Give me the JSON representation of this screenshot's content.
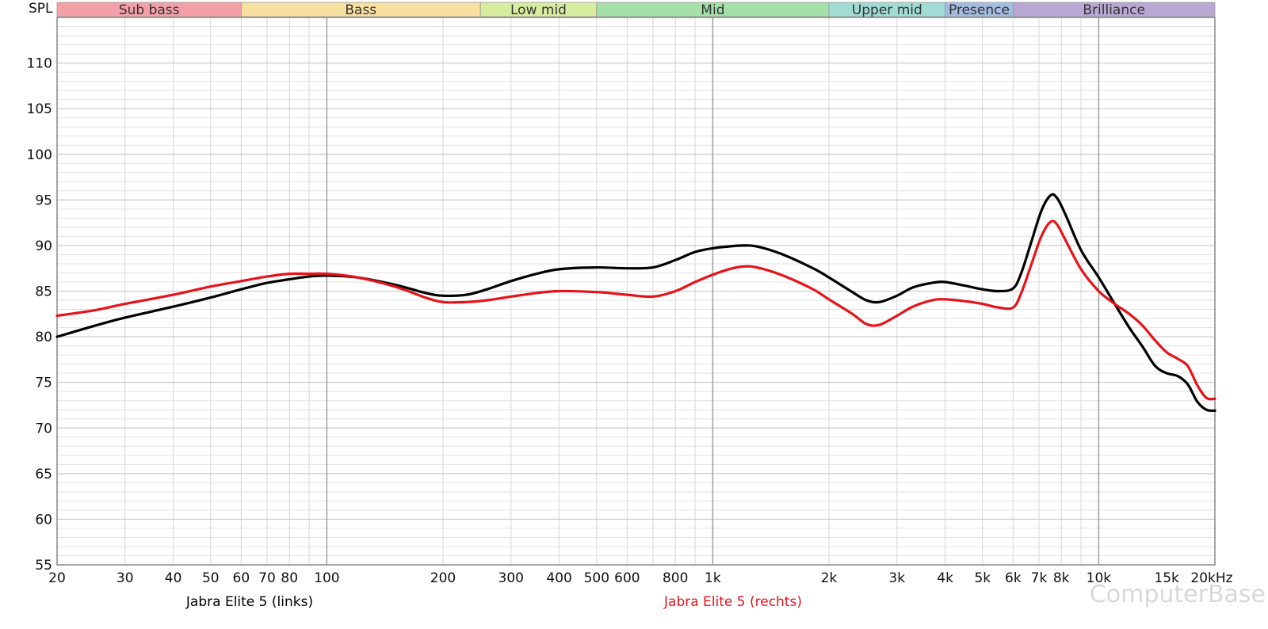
{
  "chart_data": {
    "type": "line",
    "ylabel": "SPL",
    "xscale": "log",
    "xlim": [
      20,
      20000
    ],
    "ylim": [
      55,
      115
    ],
    "grid": true,
    "xticks": [
      {
        "v": 20,
        "label": "20"
      },
      {
        "v": 30,
        "label": "30"
      },
      {
        "v": 40,
        "label": "40"
      },
      {
        "v": 50,
        "label": "50"
      },
      {
        "v": 60,
        "label": "60"
      },
      {
        "v": 70,
        "label": "70"
      },
      {
        "v": 80,
        "label": "80"
      },
      {
        "v": 100,
        "label": "100"
      },
      {
        "v": 200,
        "label": "200"
      },
      {
        "v": 300,
        "label": "300"
      },
      {
        "v": 400,
        "label": "400"
      },
      {
        "v": 500,
        "label": "500"
      },
      {
        "v": 600,
        "label": "600"
      },
      {
        "v": 800,
        "label": "800"
      },
      {
        "v": 1000,
        "label": "1k"
      },
      {
        "v": 2000,
        "label": "2k"
      },
      {
        "v": 3000,
        "label": "3k"
      },
      {
        "v": 4000,
        "label": "4k"
      },
      {
        "v": 5000,
        "label": "5k"
      },
      {
        "v": 6000,
        "label": "6k"
      },
      {
        "v": 7000,
        "label": "7k"
      },
      {
        "v": 8000,
        "label": "8k"
      },
      {
        "v": 10000,
        "label": "10k"
      },
      {
        "v": 15000,
        "label": "15k"
      },
      {
        "v": 20000,
        "label": "20kHz"
      }
    ],
    "yticks": [
      55,
      60,
      65,
      70,
      75,
      80,
      85,
      90,
      95,
      100,
      105,
      110
    ],
    "bands": [
      {
        "name": "Sub bass",
        "from": 20,
        "to": 60,
        "color": "#f4a0a8"
      },
      {
        "name": "Bass",
        "from": 60,
        "to": 250,
        "color": "#f8e0a0"
      },
      {
        "name": "Low mid",
        "from": 250,
        "to": 500,
        "color": "#d8eca0"
      },
      {
        "name": "Mid",
        "from": 500,
        "to": 2000,
        "color": "#a4e0a8"
      },
      {
        "name": "Upper mid",
        "from": 2000,
        "to": 4000,
        "color": "#a0dcd4"
      },
      {
        "name": "Presence",
        "from": 4000,
        "to": 6000,
        "color": "#a4bce0"
      },
      {
        "name": "Brilliance",
        "from": 6000,
        "to": 20000,
        "color": "#b8a8d4"
      }
    ],
    "series": [
      {
        "name": "Jabra Elite 5 (links)",
        "color": "#000000",
        "points": [
          [
            20,
            80.0
          ],
          [
            25,
            81.2
          ],
          [
            30,
            82.1
          ],
          [
            40,
            83.3
          ],
          [
            50,
            84.3
          ],
          [
            60,
            85.2
          ],
          [
            70,
            85.9
          ],
          [
            80,
            86.3
          ],
          [
            90,
            86.6
          ],
          [
            100,
            86.7
          ],
          [
            120,
            86.5
          ],
          [
            150,
            85.7
          ],
          [
            180,
            84.8
          ],
          [
            200,
            84.5
          ],
          [
            230,
            84.6
          ],
          [
            260,
            85.2
          ],
          [
            300,
            86.1
          ],
          [
            350,
            86.9
          ],
          [
            400,
            87.4
          ],
          [
            500,
            87.6
          ],
          [
            600,
            87.5
          ],
          [
            700,
            87.6
          ],
          [
            800,
            88.4
          ],
          [
            900,
            89.3
          ],
          [
            1000,
            89.7
          ],
          [
            1100,
            89.9
          ],
          [
            1200,
            90.0
          ],
          [
            1300,
            89.9
          ],
          [
            1500,
            89.1
          ],
          [
            1800,
            87.6
          ],
          [
            2000,
            86.5
          ],
          [
            2300,
            84.9
          ],
          [
            2500,
            84.0
          ],
          [
            2700,
            83.8
          ],
          [
            3000,
            84.5
          ],
          [
            3300,
            85.4
          ],
          [
            3700,
            85.9
          ],
          [
            4000,
            86.0
          ],
          [
            4500,
            85.6
          ],
          [
            5000,
            85.2
          ],
          [
            5500,
            85.0
          ],
          [
            6000,
            85.3
          ],
          [
            6300,
            87.0
          ],
          [
            6700,
            90.5
          ],
          [
            7100,
            93.8
          ],
          [
            7500,
            95.5
          ],
          [
            7800,
            95.2
          ],
          [
            8200,
            93.4
          ],
          [
            9000,
            89.5
          ],
          [
            10000,
            86.5
          ],
          [
            11000,
            83.6
          ],
          [
            12000,
            81.0
          ],
          [
            13000,
            78.9
          ],
          [
            14000,
            76.8
          ],
          [
            15000,
            76.0
          ],
          [
            16000,
            75.7
          ],
          [
            17000,
            74.8
          ],
          [
            18000,
            72.9
          ],
          [
            19000,
            72.0
          ],
          [
            20000,
            71.9
          ]
        ]
      },
      {
        "name": "Jabra Elite 5 (rechts)",
        "color": "#e8121a",
        "points": [
          [
            20,
            82.3
          ],
          [
            25,
            82.9
          ],
          [
            30,
            83.6
          ],
          [
            40,
            84.6
          ],
          [
            50,
            85.5
          ],
          [
            60,
            86.1
          ],
          [
            70,
            86.6
          ],
          [
            80,
            86.9
          ],
          [
            90,
            86.9
          ],
          [
            100,
            86.9
          ],
          [
            120,
            86.5
          ],
          [
            150,
            85.5
          ],
          [
            180,
            84.3
          ],
          [
            200,
            83.8
          ],
          [
            230,
            83.8
          ],
          [
            260,
            84.0
          ],
          [
            300,
            84.4
          ],
          [
            350,
            84.8
          ],
          [
            400,
            85.0
          ],
          [
            500,
            84.9
          ],
          [
            600,
            84.6
          ],
          [
            700,
            84.4
          ],
          [
            800,
            85.0
          ],
          [
            900,
            86.0
          ],
          [
            1000,
            86.8
          ],
          [
            1100,
            87.4
          ],
          [
            1200,
            87.7
          ],
          [
            1300,
            87.6
          ],
          [
            1500,
            86.8
          ],
          [
            1800,
            85.3
          ],
          [
            2000,
            84.1
          ],
          [
            2300,
            82.5
          ],
          [
            2500,
            81.4
          ],
          [
            2700,
            81.3
          ],
          [
            3000,
            82.3
          ],
          [
            3300,
            83.3
          ],
          [
            3700,
            84.0
          ],
          [
            4000,
            84.1
          ],
          [
            4500,
            83.9
          ],
          [
            5000,
            83.6
          ],
          [
            5500,
            83.2
          ],
          [
            6000,
            83.2
          ],
          [
            6300,
            84.8
          ],
          [
            6700,
            88.0
          ],
          [
            7100,
            91.0
          ],
          [
            7500,
            92.6
          ],
          [
            7800,
            92.3
          ],
          [
            8200,
            90.6
          ],
          [
            9000,
            87.4
          ],
          [
            10000,
            85.0
          ],
          [
            11000,
            83.6
          ],
          [
            12000,
            82.5
          ],
          [
            13000,
            81.2
          ],
          [
            14000,
            79.6
          ],
          [
            15000,
            78.3
          ],
          [
            16000,
            77.6
          ],
          [
            17000,
            76.8
          ],
          [
            18000,
            74.7
          ],
          [
            19000,
            73.3
          ],
          [
            20000,
            73.2
          ]
        ]
      }
    ],
    "watermark": "ComputerBase"
  }
}
